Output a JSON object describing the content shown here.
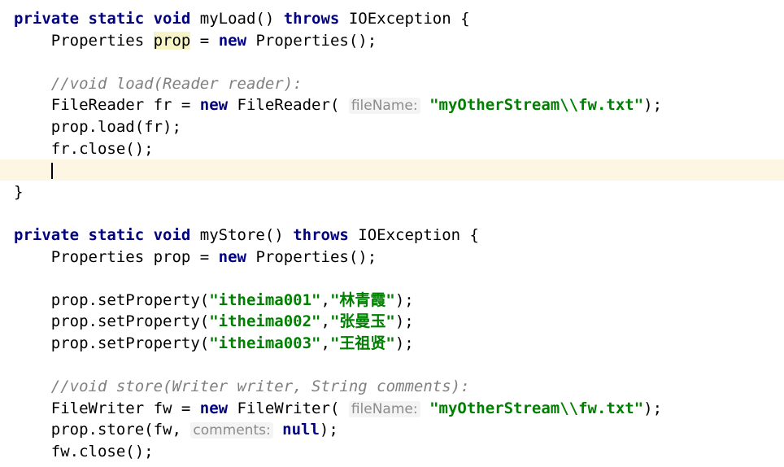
{
  "editor": {
    "lines": [
      {
        "id": "l1",
        "tokens": [
          [
            "private static void",
            "kw"
          ],
          [
            " myLoad() ",
            ""
          ],
          [
            "throws",
            "kw"
          ],
          [
            " IOException {",
            ""
          ]
        ]
      },
      {
        "id": "l2",
        "tokens": [
          [
            "    Properties ",
            ""
          ],
          [
            "prop",
            "hl"
          ],
          [
            " = ",
            ""
          ],
          [
            "new",
            "kw"
          ],
          [
            " Properties();",
            ""
          ]
        ]
      },
      {
        "id": "l3",
        "tokens": []
      },
      {
        "id": "l4",
        "tokens": [
          [
            "    ",
            ""
          ],
          [
            "//void load(Reader reader):",
            "cm"
          ]
        ]
      },
      {
        "id": "l5",
        "tokens": [
          [
            "    FileReader fr = ",
            ""
          ],
          [
            "new",
            "kw"
          ],
          [
            " FileReader( ",
            ""
          ],
          [
            "fileName:",
            "hint"
          ],
          [
            " ",
            ""
          ],
          [
            "\"myOtherStream\\\\fw.txt\"",
            "str"
          ],
          [
            ");",
            ""
          ]
        ]
      },
      {
        "id": "l6",
        "tokens": [
          [
            "    prop.load(fr);",
            ""
          ]
        ]
      },
      {
        "id": "l7",
        "tokens": [
          [
            "    fr.close();",
            ""
          ]
        ]
      },
      {
        "id": "l8",
        "tokens": [
          [
            "    ",
            ""
          ],
          [
            "|",
            "caret"
          ]
        ],
        "current": true
      },
      {
        "id": "l9",
        "tokens": [
          [
            "}",
            ""
          ]
        ]
      },
      {
        "id": "l10",
        "tokens": []
      },
      {
        "id": "l11",
        "tokens": [
          [
            "private static void",
            "kw"
          ],
          [
            " myStore() ",
            ""
          ],
          [
            "throws",
            "kw"
          ],
          [
            " IOException {",
            ""
          ]
        ]
      },
      {
        "id": "l12",
        "tokens": [
          [
            "    Properties prop = ",
            ""
          ],
          [
            "new",
            "kw"
          ],
          [
            " Properties();",
            ""
          ]
        ]
      },
      {
        "id": "l13",
        "tokens": []
      },
      {
        "id": "l14",
        "tokens": [
          [
            "    prop.setProperty(",
            ""
          ],
          [
            "\"itheima001\"",
            "str"
          ],
          [
            ",",
            ""
          ],
          [
            "\"林青霞\"",
            "str"
          ],
          [
            ");",
            ""
          ]
        ]
      },
      {
        "id": "l15",
        "tokens": [
          [
            "    prop.setProperty(",
            ""
          ],
          [
            "\"itheima002\"",
            "str"
          ],
          [
            ",",
            ""
          ],
          [
            "\"张曼玉\"",
            "str"
          ],
          [
            ");",
            ""
          ]
        ]
      },
      {
        "id": "l16",
        "tokens": [
          [
            "    prop.setProperty(",
            ""
          ],
          [
            "\"itheima003\"",
            "str"
          ],
          [
            ",",
            ""
          ],
          [
            "\"王祖贤\"",
            "str"
          ],
          [
            ");",
            ""
          ]
        ]
      },
      {
        "id": "l17",
        "tokens": []
      },
      {
        "id": "l18",
        "tokens": [
          [
            "    ",
            ""
          ],
          [
            "//void store(Writer writer, String comments):",
            "cm"
          ]
        ]
      },
      {
        "id": "l19",
        "tokens": [
          [
            "    FileWriter fw = ",
            ""
          ],
          [
            "new",
            "kw"
          ],
          [
            " FileWriter( ",
            ""
          ],
          [
            "fileName:",
            "hint"
          ],
          [
            " ",
            ""
          ],
          [
            "\"myOtherStream\\\\fw.txt\"",
            "str"
          ],
          [
            ");",
            ""
          ]
        ]
      },
      {
        "id": "l20",
        "tokens": [
          [
            "    prop.store(fw, ",
            ""
          ],
          [
            "comments:",
            "hint"
          ],
          [
            " ",
            ""
          ],
          [
            "null",
            "kw"
          ],
          [
            ");",
            ""
          ]
        ]
      },
      {
        "id": "l21",
        "tokens": [
          [
            "    fw.close();",
            ""
          ]
        ]
      }
    ]
  },
  "colors": {
    "keyword": "#000080",
    "string": "#008000",
    "comment": "#808080",
    "hint": "#8c8c8c",
    "current_line": "#fdf6e3"
  }
}
